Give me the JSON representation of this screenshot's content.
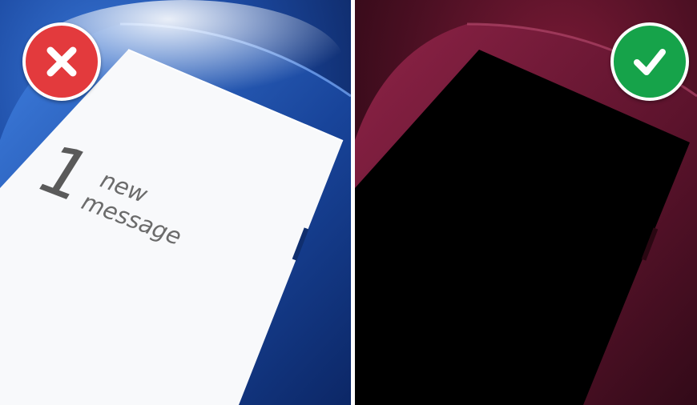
{
  "comparison": {
    "bad": {
      "icon": "cross-icon",
      "color": "#e33a3d",
      "screen": {
        "number": "1",
        "line1": "new",
        "line2": "message"
      },
      "background": "#1f4a9e"
    },
    "good": {
      "icon": "check-icon",
      "color": "#16a34a",
      "background": "#5e1428"
    }
  }
}
